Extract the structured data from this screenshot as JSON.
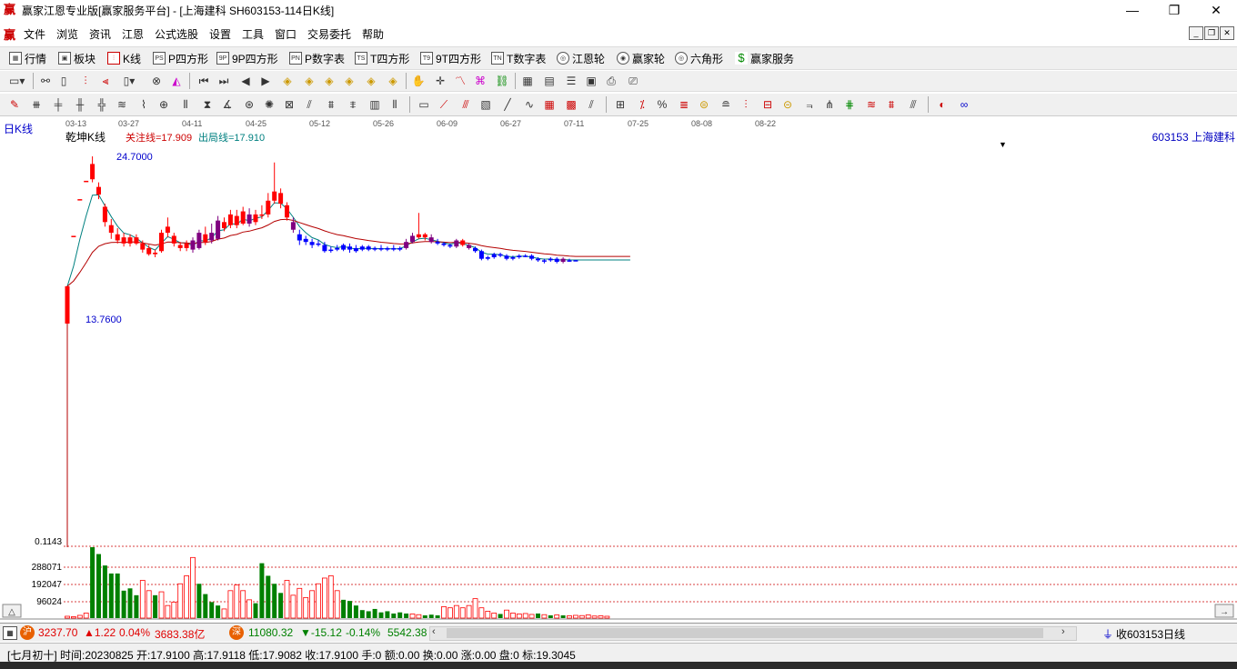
{
  "window": {
    "title": "赢家江恩专业版[赢家服务平台] - [上海建科  SH603153-114日K线]",
    "app_icon": "赢",
    "minimize": "—",
    "restore": "❐",
    "close": "✕"
  },
  "menu": {
    "logo": "赢",
    "items": [
      "文件",
      "浏览",
      "资讯",
      "江恩",
      "公式选股",
      "设置",
      "工具",
      "窗口",
      "交易委托",
      "帮助"
    ]
  },
  "toolbar1": {
    "items": [
      {
        "icon": "grid-icon",
        "icon_text": "▦",
        "label": "行情"
      },
      {
        "icon": "blocks-icon",
        "icon_text": "▣",
        "label": "板块"
      },
      {
        "icon": "kline-icon",
        "icon_text": "⫶",
        "label": "K线"
      },
      {
        "icon": "p-square-icon",
        "icon_text": "PS",
        "label": "P四方形"
      },
      {
        "icon": "9p-square-icon",
        "icon_text": "9P",
        "label": "9P四方形"
      },
      {
        "icon": "p-number-icon",
        "icon_text": "PN",
        "label": "P数字表"
      },
      {
        "icon": "t-square-icon",
        "icon_text": "TS",
        "label": "T四方形"
      },
      {
        "icon": "9t-square-icon",
        "icon_text": "T9",
        "label": "9T四方形"
      },
      {
        "icon": "t-number-icon",
        "icon_text": "TN",
        "label": "T数字表"
      },
      {
        "icon": "gann-wheel-icon",
        "icon_text": "◎",
        "label": "江恩轮"
      },
      {
        "icon": "winner-wheel-icon",
        "icon_text": "◉",
        "label": "赢家轮"
      },
      {
        "icon": "hexagon-icon",
        "icon_text": "◎",
        "label": "六角形"
      },
      {
        "icon": "dollar-icon",
        "icon_text": "$",
        "label": "赢家服务"
      }
    ]
  },
  "chart_header": {
    "period": "日K线",
    "indicator": "乾坤K线",
    "attention_line": "关注线=17.909",
    "exit_line": "出局线=17.910",
    "stock": "603153  上海建科",
    "dates": [
      "03-13",
      "03-27",
      "04-11",
      "04-25",
      "05-12",
      "05-26",
      "06-09",
      "06-27",
      "07-11",
      "07-25",
      "08-08",
      "08-22"
    ],
    "high_label": "24.7000",
    "low_label": "13.7600",
    "vol_axis": [
      "0.1143",
      "288071",
      "192047",
      "96024"
    ]
  },
  "chart_data": {
    "type": "candlestick",
    "title": "乾坤K线",
    "x_ticks": [
      "03-13",
      "03-27",
      "04-11",
      "04-25",
      "05-12",
      "05-26",
      "06-09",
      "06-27",
      "07-11",
      "07-25",
      "08-08",
      "08-22"
    ],
    "price_labels": {
      "high": 24.7,
      "low": 13.76
    },
    "reference_lines": {
      "attention": 17.909,
      "exit": 17.91
    },
    "volume_axis_ticks": [
      0.1143,
      288071,
      192047,
      96024
    ],
    "candles": [
      {
        "o": 13.76,
        "c": 16.2,
        "h": 16.2,
        "l": 13.76,
        "col": "red"
      },
      {
        "o": 19.5,
        "c": 19.5,
        "h": 19.5,
        "l": 19.5,
        "col": "red"
      },
      {
        "o": 21.9,
        "c": 21.9,
        "h": 21.9,
        "l": 21.9,
        "col": "red"
      },
      {
        "o": 23.1,
        "c": 23.1,
        "h": 23.1,
        "l": 23.1,
        "col": "red"
      },
      {
        "o": 23.2,
        "c": 24.2,
        "h": 24.7,
        "l": 23.0,
        "col": "red"
      },
      {
        "o": 22.7,
        "c": 22.2,
        "h": 23.0,
        "l": 21.9,
        "col": "red"
      },
      {
        "o": 21.4,
        "c": 20.4,
        "h": 21.6,
        "l": 20.1,
        "col": "red"
      },
      {
        "o": 20.2,
        "c": 19.7,
        "h": 20.6,
        "l": 19.3,
        "col": "red"
      },
      {
        "o": 19.6,
        "c": 19.2,
        "h": 20.0,
        "l": 19.0,
        "col": "red"
      },
      {
        "o": 19.4,
        "c": 19.0,
        "h": 19.7,
        "l": 18.8,
        "col": "red"
      },
      {
        "o": 19.0,
        "c": 19.4,
        "h": 19.6,
        "l": 18.8,
        "col": "red"
      },
      {
        "o": 19.4,
        "c": 19.0,
        "h": 19.6,
        "l": 18.9,
        "col": "red"
      },
      {
        "o": 19.0,
        "c": 18.6,
        "h": 19.2,
        "l": 18.4,
        "col": "red"
      },
      {
        "o": 18.7,
        "c": 18.3,
        "h": 18.9,
        "l": 18.2,
        "col": "red"
      },
      {
        "o": 18.4,
        "c": 18.3,
        "h": 18.6,
        "l": 18.1,
        "col": "red"
      },
      {
        "o": 18.5,
        "c": 19.7,
        "h": 19.9,
        "l": 18.4,
        "col": "red"
      },
      {
        "o": 19.7,
        "c": 20.1,
        "h": 20.7,
        "l": 19.4,
        "col": "red"
      },
      {
        "o": 19.5,
        "c": 19.0,
        "h": 19.7,
        "l": 18.8,
        "col": "red"
      },
      {
        "o": 18.9,
        "c": 18.7,
        "h": 19.1,
        "l": 18.5,
        "col": "red"
      },
      {
        "o": 18.7,
        "c": 19.0,
        "h": 19.2,
        "l": 18.5,
        "col": "red"
      },
      {
        "o": 19.2,
        "c": 18.6,
        "h": 19.4,
        "l": 18.4,
        "col": "purple"
      },
      {
        "o": 18.7,
        "c": 19.7,
        "h": 19.9,
        "l": 18.6,
        "col": "purple"
      },
      {
        "o": 19.6,
        "c": 19.1,
        "h": 20.1,
        "l": 18.9,
        "col": "red"
      },
      {
        "o": 19.2,
        "c": 19.7,
        "h": 20.3,
        "l": 19.0,
        "col": "purple"
      },
      {
        "o": 19.3,
        "c": 20.5,
        "h": 20.8,
        "l": 19.2,
        "col": "purple"
      },
      {
        "o": 20.4,
        "c": 20.0,
        "h": 20.7,
        "l": 19.8,
        "col": "red"
      },
      {
        "o": 20.2,
        "c": 20.9,
        "h": 21.2,
        "l": 20.0,
        "col": "red"
      },
      {
        "o": 20.8,
        "c": 20.2,
        "h": 21.2,
        "l": 20.0,
        "col": "red"
      },
      {
        "o": 20.3,
        "c": 21.1,
        "h": 21.4,
        "l": 20.2,
        "col": "red"
      },
      {
        "o": 20.9,
        "c": 20.3,
        "h": 21.3,
        "l": 20.1,
        "col": "purple"
      },
      {
        "o": 20.4,
        "c": 20.9,
        "h": 21.2,
        "l": 20.2,
        "col": "red"
      },
      {
        "o": 20.9,
        "c": 20.9,
        "h": 21.5,
        "l": 20.6,
        "col": "red"
      },
      {
        "o": 20.9,
        "c": 21.8,
        "h": 22.3,
        "l": 20.7,
        "col": "red"
      },
      {
        "o": 21.8,
        "c": 22.4,
        "h": 24.3,
        "l": 21.6,
        "col": "red"
      },
      {
        "o": 22.3,
        "c": 21.6,
        "h": 22.6,
        "l": 21.3,
        "col": "red"
      },
      {
        "o": 21.5,
        "c": 20.7,
        "h": 21.7,
        "l": 20.5,
        "col": "red"
      },
      {
        "o": 20.4,
        "c": 19.9,
        "h": 20.7,
        "l": 19.7,
        "col": "purple"
      },
      {
        "o": 19.6,
        "c": 19.2,
        "h": 19.9,
        "l": 18.9,
        "col": "blue"
      },
      {
        "o": 19.3,
        "c": 19.1,
        "h": 19.5,
        "l": 18.9,
        "col": "blue"
      },
      {
        "o": 19.1,
        "c": 18.9,
        "h": 19.3,
        "l": 18.7,
        "col": "blue"
      },
      {
        "o": 19.0,
        "c": 19.0,
        "h": 19.2,
        "l": 18.8,
        "col": "blue"
      },
      {
        "o": 18.9,
        "c": 18.5,
        "h": 19.1,
        "l": 18.4,
        "col": "blue"
      },
      {
        "o": 18.6,
        "c": 18.6,
        "h": 18.8,
        "l": 18.4,
        "col": "blue"
      },
      {
        "o": 18.7,
        "c": 18.6,
        "h": 18.9,
        "l": 18.5,
        "col": "blue"
      },
      {
        "o": 18.6,
        "c": 18.9,
        "h": 19.0,
        "l": 18.5,
        "col": "blue"
      },
      {
        "o": 18.8,
        "c": 18.6,
        "h": 19.0,
        "l": 18.4,
        "col": "blue"
      },
      {
        "o": 18.7,
        "c": 18.5,
        "h": 18.9,
        "l": 18.4,
        "col": "blue"
      },
      {
        "o": 18.6,
        "c": 18.8,
        "h": 18.9,
        "l": 18.5,
        "col": "blue"
      },
      {
        "o": 18.8,
        "c": 18.6,
        "h": 18.9,
        "l": 18.5,
        "col": "blue"
      },
      {
        "o": 18.6,
        "c": 18.7,
        "h": 18.8,
        "l": 18.5,
        "col": "blue"
      },
      {
        "o": 18.7,
        "c": 18.6,
        "h": 18.9,
        "l": 18.5,
        "col": "blue"
      },
      {
        "o": 18.6,
        "c": 18.7,
        "h": 18.8,
        "l": 18.5,
        "col": "blue"
      },
      {
        "o": 18.7,
        "c": 18.6,
        "h": 18.9,
        "l": 18.5,
        "col": "blue"
      },
      {
        "o": 18.6,
        "c": 18.7,
        "h": 18.8,
        "l": 18.5,
        "col": "blue"
      },
      {
        "o": 18.7,
        "c": 19.1,
        "h": 19.3,
        "l": 18.6,
        "col": "purple"
      },
      {
        "o": 19.1,
        "c": 19.5,
        "h": 19.7,
        "l": 19.0,
        "col": "purple"
      },
      {
        "o": 19.4,
        "c": 19.6,
        "h": 21.0,
        "l": 19.3,
        "col": "red"
      },
      {
        "o": 19.6,
        "c": 19.4,
        "h": 19.7,
        "l": 19.2,
        "col": "red"
      },
      {
        "o": 19.4,
        "c": 19.1,
        "h": 19.6,
        "l": 19.0,
        "col": "purple"
      },
      {
        "o": 19.1,
        "c": 19.0,
        "h": 19.3,
        "l": 18.9,
        "col": "blue"
      },
      {
        "o": 19.0,
        "c": 18.9,
        "h": 19.1,
        "l": 18.8,
        "col": "blue"
      },
      {
        "o": 18.9,
        "c": 18.8,
        "h": 19.0,
        "l": 18.7,
        "col": "blue"
      },
      {
        "o": 18.8,
        "c": 19.2,
        "h": 19.3,
        "l": 18.7,
        "col": "purple"
      },
      {
        "o": 19.2,
        "c": 18.9,
        "h": 19.3,
        "l": 18.8,
        "col": "red"
      },
      {
        "o": 18.9,
        "c": 18.7,
        "h": 19.0,
        "l": 18.6,
        "col": "purple"
      },
      {
        "o": 18.7,
        "c": 18.5,
        "h": 18.8,
        "l": 18.4,
        "col": "blue"
      },
      {
        "o": 18.5,
        "c": 18.0,
        "h": 18.6,
        "l": 17.9,
        "col": "blue"
      },
      {
        "o": 18.0,
        "c": 18.1,
        "h": 18.2,
        "l": 17.9,
        "col": "blue"
      },
      {
        "o": 18.1,
        "c": 18.3,
        "h": 18.4,
        "l": 18.0,
        "col": "blue"
      },
      {
        "o": 18.3,
        "c": 18.2,
        "h": 18.4,
        "l": 18.1,
        "col": "blue"
      },
      {
        "o": 18.2,
        "c": 18.0,
        "h": 18.3,
        "l": 17.9,
        "col": "blue"
      },
      {
        "o": 18.0,
        "c": 18.1,
        "h": 18.2,
        "l": 17.9,
        "col": "blue"
      },
      {
        "o": 18.1,
        "c": 18.2,
        "h": 18.3,
        "l": 18.0,
        "col": "blue"
      },
      {
        "o": 18.2,
        "c": 18.2,
        "h": 18.3,
        "l": 18.1,
        "col": "blue"
      },
      {
        "o": 18.2,
        "c": 18.0,
        "h": 18.3,
        "l": 17.9,
        "col": "blue"
      },
      {
        "o": 18.0,
        "c": 17.9,
        "h": 18.1,
        "l": 17.8,
        "col": "blue"
      },
      {
        "o": 17.9,
        "c": 17.9,
        "h": 18.0,
        "l": 17.7,
        "col": "blue"
      },
      {
        "o": 17.9,
        "c": 18.0,
        "h": 18.1,
        "l": 17.8,
        "col": "blue"
      },
      {
        "o": 18.0,
        "c": 17.8,
        "h": 18.1,
        "l": 17.7,
        "col": "blue"
      },
      {
        "o": 17.8,
        "c": 18.0,
        "h": 18.1,
        "l": 17.7,
        "col": "purple"
      },
      {
        "o": 17.9,
        "c": 17.9,
        "h": 18.0,
        "l": 17.8,
        "col": "blue"
      },
      {
        "o": 17.91,
        "c": 17.91,
        "h": 17.912,
        "l": 17.908,
        "col": "blue"
      }
    ],
    "volume": [
      {
        "v": 8000,
        "col": "red"
      },
      {
        "v": 6000,
        "col": "red"
      },
      {
        "v": 12000,
        "col": "red"
      },
      {
        "v": 22000,
        "col": "red"
      },
      {
        "v": 310000,
        "col": "green"
      },
      {
        "v": 280000,
        "col": "green"
      },
      {
        "v": 230000,
        "col": "green"
      },
      {
        "v": 195000,
        "col": "green"
      },
      {
        "v": 195000,
        "col": "green"
      },
      {
        "v": 120000,
        "col": "green"
      },
      {
        "v": 130000,
        "col": "green"
      },
      {
        "v": 100000,
        "col": "green"
      },
      {
        "v": 165000,
        "col": "red"
      },
      {
        "v": 120000,
        "col": "red"
      },
      {
        "v": 100000,
        "col": "green"
      },
      {
        "v": 115000,
        "col": "red"
      },
      {
        "v": 55000,
        "col": "red"
      },
      {
        "v": 70000,
        "col": "red"
      },
      {
        "v": 150000,
        "col": "red"
      },
      {
        "v": 185000,
        "col": "red"
      },
      {
        "v": 265000,
        "col": "red"
      },
      {
        "v": 150000,
        "col": "green"
      },
      {
        "v": 105000,
        "col": "green"
      },
      {
        "v": 70000,
        "col": "green"
      },
      {
        "v": 55000,
        "col": "green"
      },
      {
        "v": 40000,
        "col": "red"
      },
      {
        "v": 120000,
        "col": "red"
      },
      {
        "v": 145000,
        "col": "red"
      },
      {
        "v": 120000,
        "col": "red"
      },
      {
        "v": 80000,
        "col": "red"
      },
      {
        "v": 65000,
        "col": "green"
      },
      {
        "v": 240000,
        "col": "green"
      },
      {
        "v": 185000,
        "col": "green"
      },
      {
        "v": 150000,
        "col": "green"
      },
      {
        "v": 110000,
        "col": "green"
      },
      {
        "v": 165000,
        "col": "red"
      },
      {
        "v": 100000,
        "col": "red"
      },
      {
        "v": 130000,
        "col": "red"
      },
      {
        "v": 90000,
        "col": "red"
      },
      {
        "v": 120000,
        "col": "red"
      },
      {
        "v": 150000,
        "col": "red"
      },
      {
        "v": 175000,
        "col": "red"
      },
      {
        "v": 185000,
        "col": "red"
      },
      {
        "v": 120000,
        "col": "red"
      },
      {
        "v": 80000,
        "col": "green"
      },
      {
        "v": 75000,
        "col": "green"
      },
      {
        "v": 55000,
        "col": "green"
      },
      {
        "v": 35000,
        "col": "green"
      },
      {
        "v": 30000,
        "col": "green"
      },
      {
        "v": 40000,
        "col": "green"
      },
      {
        "v": 25000,
        "col": "green"
      },
      {
        "v": 30000,
        "col": "green"
      },
      {
        "v": 20000,
        "col": "green"
      },
      {
        "v": 25000,
        "col": "green"
      },
      {
        "v": 20000,
        "col": "green"
      },
      {
        "v": 18000,
        "col": "red"
      },
      {
        "v": 15000,
        "col": "red"
      },
      {
        "v": 12000,
        "col": "green"
      },
      {
        "v": 15000,
        "col": "green"
      },
      {
        "v": 12000,
        "col": "green"
      },
      {
        "v": 50000,
        "col": "red"
      },
      {
        "v": 45000,
        "col": "red"
      },
      {
        "v": 55000,
        "col": "red"
      },
      {
        "v": 45000,
        "col": "red"
      },
      {
        "v": 55000,
        "col": "red"
      },
      {
        "v": 85000,
        "col": "red"
      },
      {
        "v": 45000,
        "col": "red"
      },
      {
        "v": 30000,
        "col": "red"
      },
      {
        "v": 22000,
        "col": "red"
      },
      {
        "v": 18000,
        "col": "green"
      },
      {
        "v": 35000,
        "col": "red"
      },
      {
        "v": 22000,
        "col": "red"
      },
      {
        "v": 18000,
        "col": "red"
      },
      {
        "v": 20000,
        "col": "red"
      },
      {
        "v": 16000,
        "col": "red"
      },
      {
        "v": 20000,
        "col": "green"
      },
      {
        "v": 15000,
        "col": "red"
      },
      {
        "v": 12000,
        "col": "green"
      },
      {
        "v": 14000,
        "col": "red"
      },
      {
        "v": 12000,
        "col": "green"
      },
      {
        "v": 10000,
        "col": "red"
      },
      {
        "v": 12000,
        "col": "red"
      },
      {
        "v": 11000,
        "col": "red"
      },
      {
        "v": 14000,
        "col": "red"
      },
      {
        "v": 9000,
        "col": "red"
      },
      {
        "v": 10000,
        "col": "red"
      },
      {
        "v": 8000,
        "col": "red"
      }
    ]
  },
  "market_bar": {
    "sh_icon": "沪",
    "sh_price": "3237.70",
    "sh_change": "▲1.22",
    "sh_pct": "0.04%",
    "sh_amount": "3683.38亿",
    "sz_icon": "深",
    "sz_price": "11080.32",
    "sz_change": "▼-15.12",
    "sz_pct": "-0.14%",
    "sz_amount": "5542.38",
    "collect": "收603153日线"
  },
  "info_bar": {
    "text": "[七月初十] 时间:20230825 开:17.9100 高:17.9118 低:17.9082 收:17.9100 手:0 额:0.00 换:0.00 涨:0.00 盘:0 标:19.3045"
  },
  "colors": {
    "up": "#ff0000",
    "down": "#0000ff",
    "purple": "#800080",
    "vol_up": "#ff0000",
    "vol_down": "#008000",
    "ma_fast": "#008080",
    "ma_slow": "#b40000",
    "grid": "#cc0000"
  }
}
